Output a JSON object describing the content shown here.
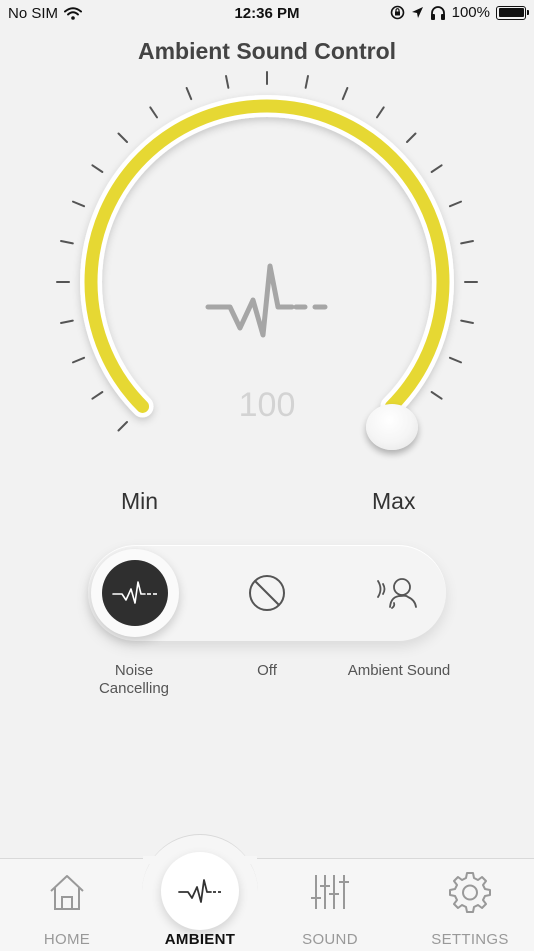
{
  "status_bar": {
    "carrier": "No SIM",
    "time": "12:36 PM",
    "battery_percent": "100%",
    "icons": [
      "wifi-icon",
      "orientation-lock-icon",
      "location-icon",
      "headphones-icon",
      "battery-icon"
    ]
  },
  "header": {
    "title": "Ambient Sound Control"
  },
  "dial": {
    "level_value": "100",
    "level_fraction": 1.0,
    "min_label": "Min",
    "max_label": "Max",
    "center_icon": "waveform-icon",
    "arc_color": "#e6d833",
    "tick_color": "#555555"
  },
  "modes": {
    "selected": "noise_cancelling",
    "items": [
      {
        "id": "noise_cancelling",
        "label_line1": "Noise",
        "label_line2": "Cancelling",
        "icon": "waveform-icon"
      },
      {
        "id": "off",
        "label": "Off",
        "icon": "off-icon"
      },
      {
        "id": "ambient",
        "label": "Ambient Sound",
        "icon": "ambient-listening-icon"
      }
    ]
  },
  "tab_bar": {
    "active": "ambient",
    "tabs": [
      {
        "id": "home",
        "label": "HOME",
        "icon": "home-icon"
      },
      {
        "id": "ambient",
        "label": "AMBIENT",
        "icon": "waveform-icon"
      },
      {
        "id": "sound",
        "label": "SOUND",
        "icon": "equalizer-icon"
      },
      {
        "id": "settings",
        "label": "SETTINGS",
        "icon": "gear-icon"
      }
    ]
  }
}
